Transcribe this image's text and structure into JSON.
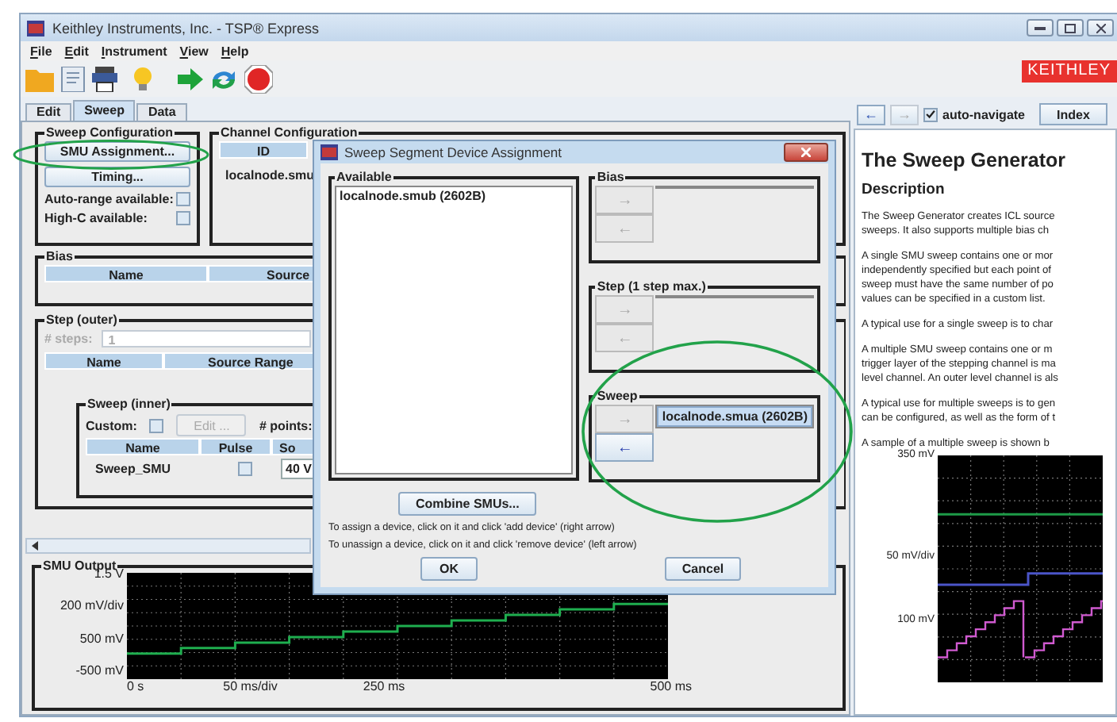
{
  "window": {
    "title": "Keithley Instruments, Inc. - TSP® Express"
  },
  "menu": [
    "File",
    "Edit",
    "Instrument",
    "View",
    "Help"
  ],
  "logo": "KEITHLEY",
  "tabs": [
    {
      "label": "Edit",
      "selected": false
    },
    {
      "label": "Sweep",
      "selected": true
    },
    {
      "label": "Data",
      "selected": false
    }
  ],
  "sweep_configuration": {
    "title": "Sweep Configuration",
    "buttons": [
      "SMU Assignment...",
      "Timing..."
    ],
    "options": [
      {
        "label": "Auto-range available:",
        "checked": false
      },
      {
        "label": "High-C available:",
        "checked": false
      }
    ]
  },
  "channel_configuration": {
    "title": "Channel Configuration",
    "columns": [
      "ID"
    ],
    "rows": [
      "localnode.smu"
    ]
  },
  "bias": {
    "title": "Bias",
    "columns": [
      "Name",
      "Source"
    ]
  },
  "step_outer": {
    "title": "Step (outer)",
    "steps_label": "# steps:",
    "steps_value": "1",
    "disabled": true,
    "columns": [
      "Name",
      "Source Range"
    ],
    "sweep_inner": {
      "title": "Sweep (inner)",
      "custom_label": "Custom:",
      "custom_checked": false,
      "edit_button": {
        "label": "Edit ...",
        "disabled": true
      },
      "points_label": "# points:",
      "columns": [
        "Name",
        "Pulse",
        "So"
      ],
      "rows": [
        {
          "name": "Sweep_SMU",
          "pulse": false,
          "source": "40 V"
        }
      ]
    }
  },
  "smu_output": {
    "title": "SMU Output",
    "y_labels": [
      "1.5 V",
      "200 mV/div",
      "500 mV",
      "-500 mV"
    ],
    "x_labels": [
      "0 s",
      "50 ms/div",
      "250 ms",
      "500 ms"
    ]
  },
  "dialog": {
    "title": "Sweep Segment Device Assignment",
    "available": {
      "title": "Available",
      "items": [
        {
          "label": "localnode.smub (2602B)",
          "selected": false
        }
      ]
    },
    "segments": [
      {
        "title": "Bias",
        "add": {
          "label": "→",
          "disabled": true
        },
        "remove": {
          "label": "←",
          "disabled": true
        }
      },
      {
        "title": "Step (1 step max.)",
        "add": {
          "label": "→",
          "disabled": true
        },
        "remove": {
          "label": "←",
          "disabled": true
        }
      },
      {
        "title": "Sweep",
        "add": {
          "label": "→",
          "disabled": true
        },
        "remove": {
          "label": "←",
          "disabled": false
        },
        "items": [
          {
            "label": "localnode.smua (2602B)",
            "selected": true
          }
        ]
      }
    ],
    "combine_button": "Combine SMUs...",
    "hints": [
      "To assign a device, click on it and click 'add device' (right arrow)",
      "To unassign a device, click on it and click 'remove device' (left arrow)"
    ],
    "buttons": [
      "OK",
      "Cancel"
    ]
  },
  "help": {
    "back": {
      "label": "←",
      "disabled": false
    },
    "forward": {
      "label": "→",
      "disabled": true
    },
    "auto_navigate": {
      "label": "auto-navigate",
      "checked": true
    },
    "index_button": "Index",
    "heading": "The Sweep Generator",
    "subheading": "Description",
    "paragraphs": [
      [
        "The Sweep Generator creates ICL source",
        "sweeps. It also supports multiple bias ch"
      ],
      [
        "A single SMU sweep contains one or mor",
        "independently specified but each point of",
        "sweep must have the same number of po",
        "values can be specified in a custom list."
      ],
      [
        "A typical use for a single sweep is to char"
      ],
      [
        "A multiple SMU sweep contains one or m",
        "trigger layer of the stepping channel is ma",
        "level channel. An outer level channel is als"
      ],
      [
        "A typical use for multiple sweeps is to gen",
        "can be configured, as well as the form of t"
      ],
      [
        "A sample of a multiple sweep is shown b"
      ]
    ],
    "chart_labels": [
      "350 mV",
      "50 mV/div",
      "100 mV"
    ]
  }
}
